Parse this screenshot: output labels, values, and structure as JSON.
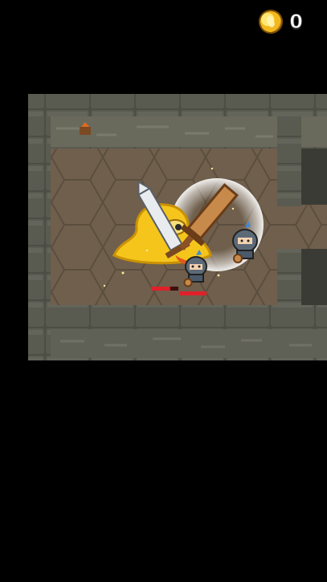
{
  "hud": {
    "coin_icon": "gold-coin-icon",
    "coin_count": "0"
  },
  "scene": {
    "room_wall_color": "#3a3b35",
    "wall_stone_color": "#55574d",
    "floor_color": "#6f5f4c",
    "boss": {
      "name": "yellow-slime-boss",
      "color": "#f5c51c",
      "health_fraction": 0.7
    },
    "hero": {
      "name": "knight-hero",
      "health_fraction": 1.0
    },
    "ally": {
      "name": "knight-ally"
    }
  }
}
